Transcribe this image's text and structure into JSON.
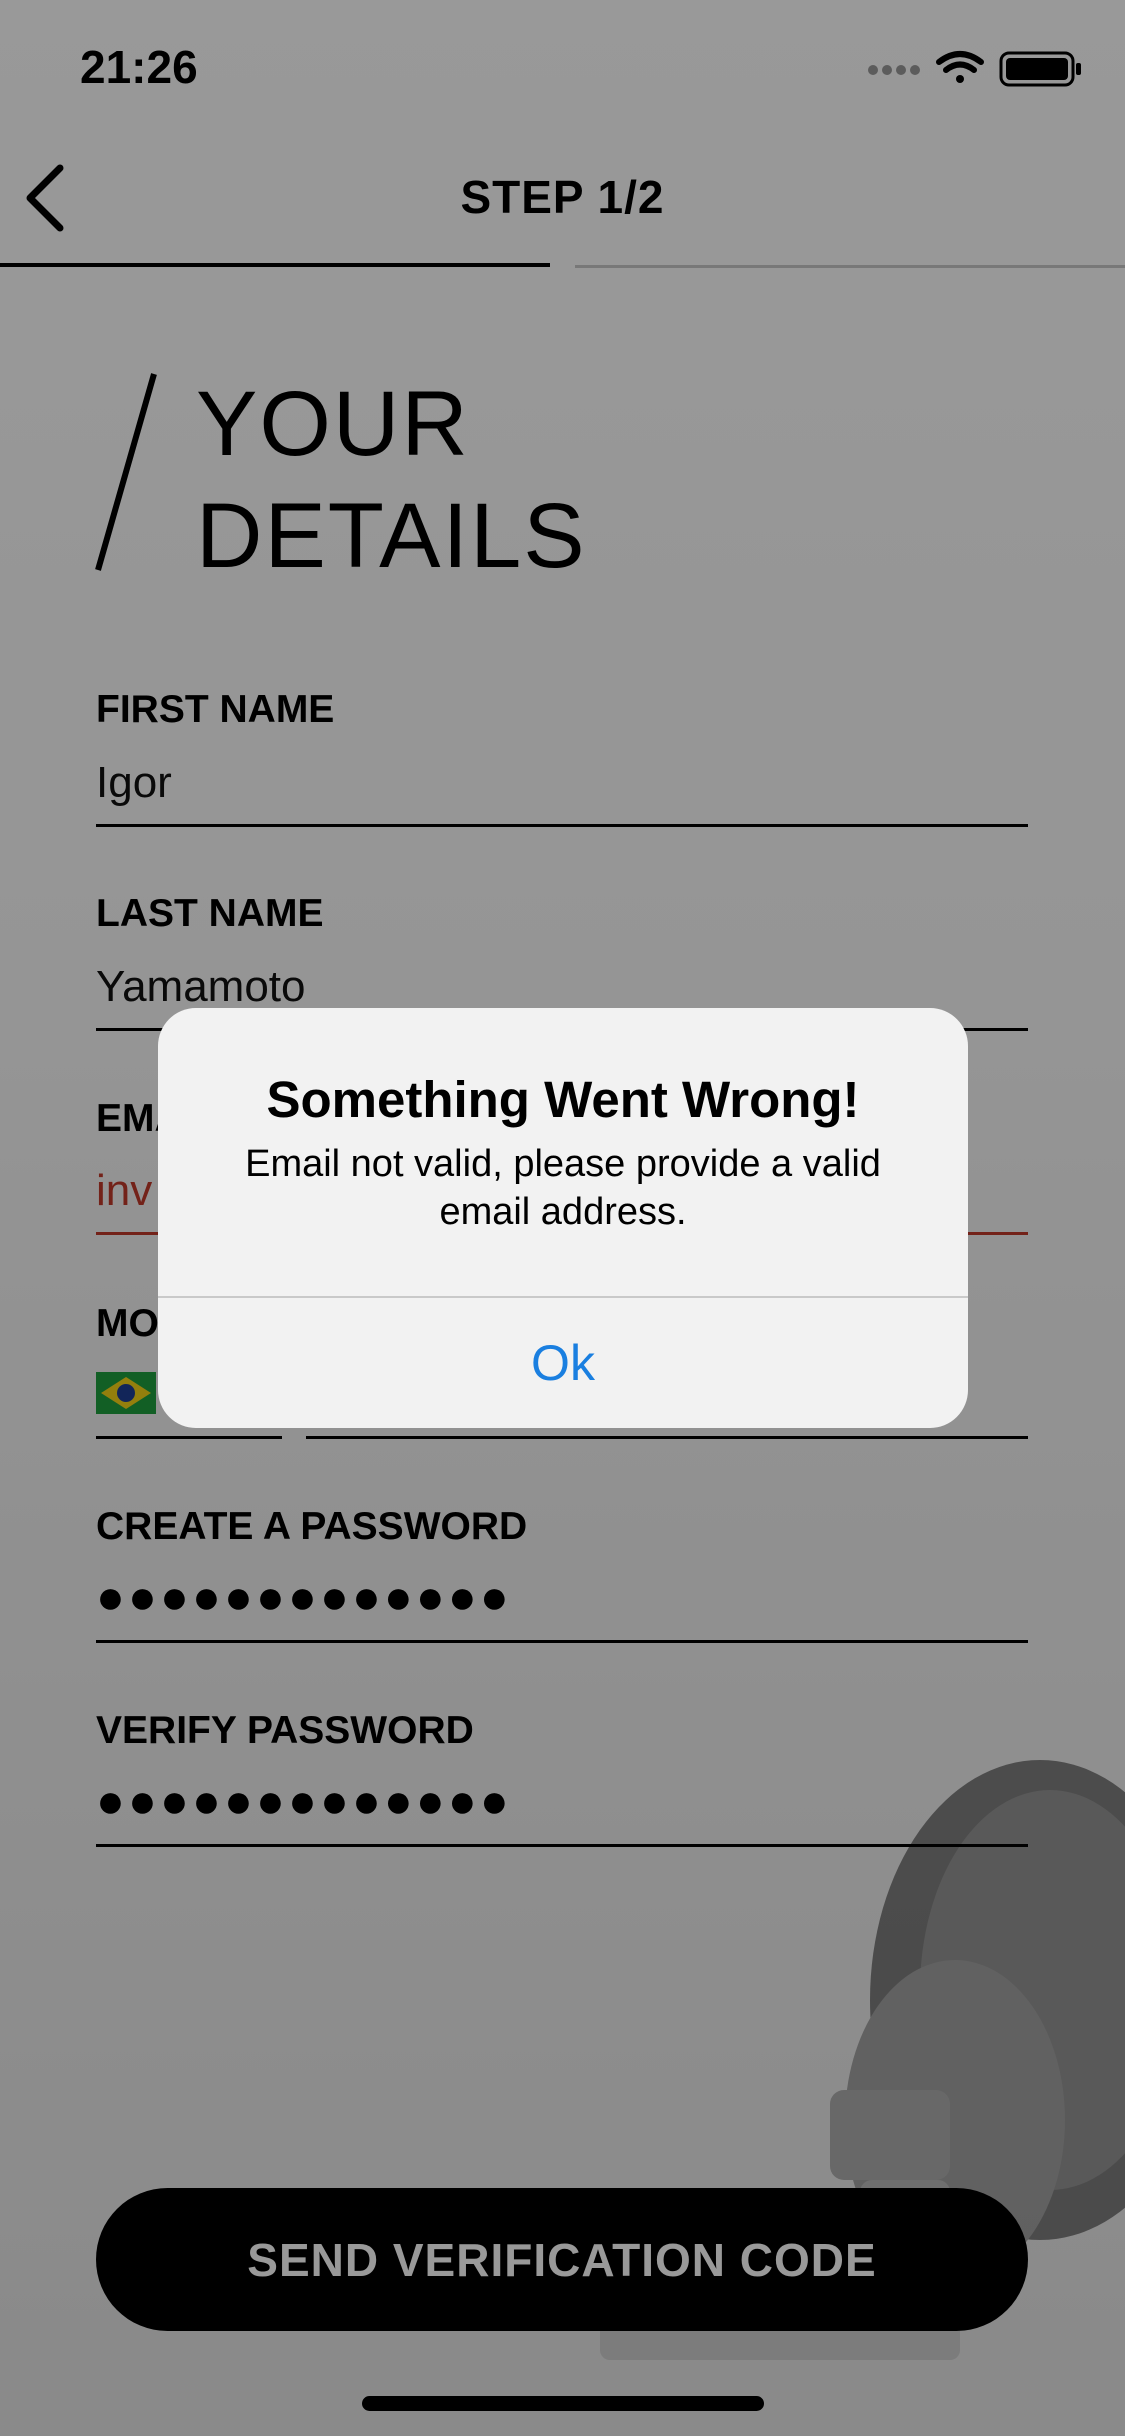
{
  "status_bar": {
    "time": "21:26"
  },
  "nav": {
    "step_title": "STEP 1/2"
  },
  "heading": {
    "line1": "YOUR",
    "line2": "DETAILS"
  },
  "form": {
    "first_name": {
      "label": "FIRST NAME",
      "value": "Igor"
    },
    "last_name": {
      "label": "LAST NAME",
      "value": "Yamamoto"
    },
    "email": {
      "label": "EMA",
      "value": "inv"
    },
    "mobile": {
      "label": "MO"
    },
    "password": {
      "label": "CREATE A PASSWORD",
      "value": "●●●●●●●●●●●●●"
    },
    "verify_password": {
      "label": "VERIFY PASSWORD",
      "value": "●●●●●●●●●●●●●"
    }
  },
  "send_button_label": "SEND VERIFICATION CODE",
  "alert": {
    "title": "Something Went Wrong!",
    "message": "Email not valid, please provide a valid email address.",
    "ok_label": "Ok"
  },
  "colors": {
    "error": "#c0392b",
    "link": "#1a7fe0"
  },
  "icons": [
    "back-chevron-icon",
    "signal-dots-icon",
    "wifi-icon",
    "battery-icon",
    "brazil-flag-icon"
  ]
}
